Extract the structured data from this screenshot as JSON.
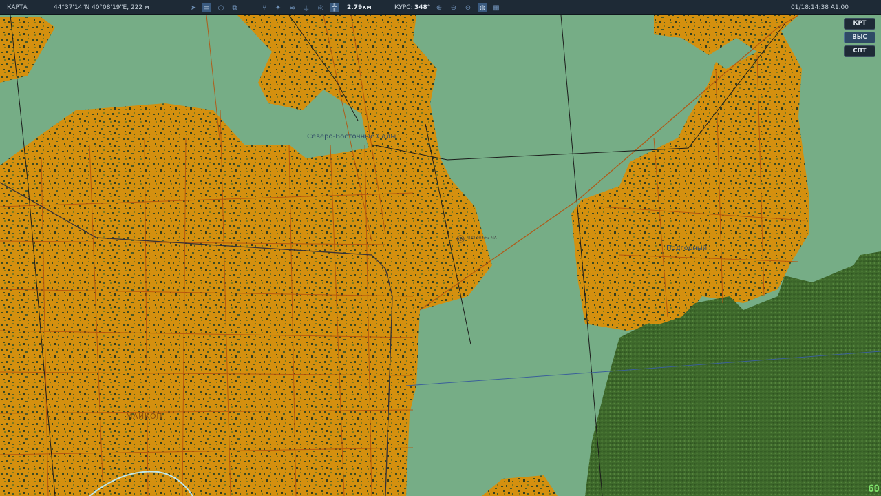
{
  "toolbar": {
    "mode_label": "КАРТА",
    "coordinates": "44°37'14\"N 40°08'19\"E, 222 м",
    "scale_value": "2.79км",
    "course_label": "КУРС:",
    "course_value": "348°",
    "datetime": "01/18:14:38 A1.00",
    "icons": [
      "navigate-icon",
      "ruler-icon",
      "circle-icon",
      "layers-icon",
      "split-icon",
      "radar-icon",
      "wifi-icon",
      "tower-icon",
      "target-icon",
      "crosshair-icon",
      "zoom-in-icon",
      "zoom-out-icon",
      "zoom-reset-icon",
      "globe-icon",
      "grid-icon"
    ]
  },
  "side_buttons": [
    {
      "label": "КРТ"
    },
    {
      "label": "ВЫС"
    },
    {
      "label": "СПТ"
    }
  ],
  "map_labels": {
    "northeast_district": "Северо-Восточные Сады",
    "beacon": "882.00 kHz MA",
    "village": "Подгорный",
    "city": "МАЙКОП"
  },
  "fps": "60",
  "colors": {
    "urban": "#d4900f",
    "field": "#76ad86",
    "forest": "#3f6a2c",
    "road": "#b5540f",
    "toolbar_bg": "#1e2a36"
  }
}
